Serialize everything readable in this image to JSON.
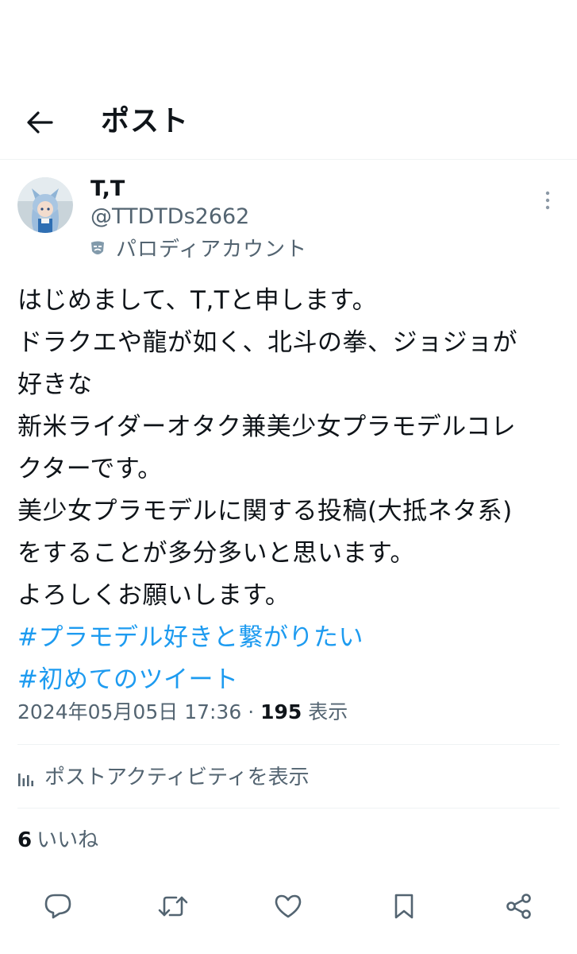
{
  "header": {
    "title": "ポスト",
    "back_icon": "arrow-left-icon"
  },
  "author": {
    "display_name": "T,T",
    "handle": "@TTDTDs2662",
    "parody_label": "パロディアカウント",
    "parody_icon": "theater-mask-icon",
    "avatar": "avatar-figure-image"
  },
  "tweet": {
    "lines": [
      "はじめまして、T,Tと申します。",
      "ドラクエや龍が如く、北斗の拳、ジョジョが",
      "好きな",
      "新米ライダーオタク兼美少女プラモデルコレ",
      "クターです。",
      "美少女プラモデルに関する投稿(大抵ネタ系)",
      "をすることが多分多いと思います。",
      "よろしくお願いします。"
    ],
    "hashtags": [
      "#プラモデル好きと繋がりたい",
      "#初めてのツイート"
    ]
  },
  "meta": {
    "timestamp": "2024年05月05日 17:36",
    "separator": " · ",
    "views_count": "195",
    "views_label": " 表示"
  },
  "activity": {
    "label": "ポストアクティビティを表示",
    "icon": "bar-chart-icon"
  },
  "likes": {
    "count": "6",
    "label": "いいね"
  },
  "actions": {
    "reply_icon": "reply-bubble-icon",
    "repost_icon": "repost-icon",
    "like_icon": "heart-icon",
    "bookmark_icon": "bookmark-icon",
    "share_icon": "share-icon"
  },
  "colors": {
    "text": "#0f1419",
    "secondary": "#536471",
    "link": "#1d9bf0",
    "divider": "#eff3f4"
  }
}
